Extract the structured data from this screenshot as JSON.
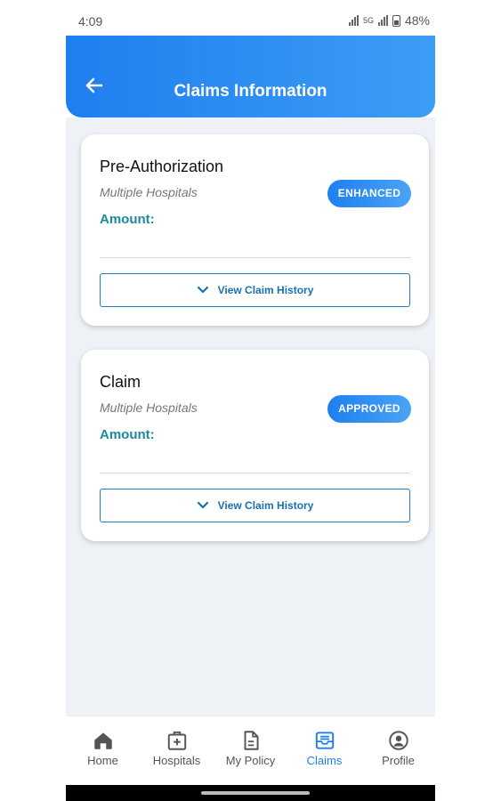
{
  "status_bar": {
    "time": "4:09",
    "network": "5G",
    "battery": "48%"
  },
  "header": {
    "title": "Claims Information"
  },
  "cards": [
    {
      "title": "Pre-Authorization",
      "subtitle": "Multiple Hospitals",
      "amount_label": "Amount:",
      "status": "ENHANCED",
      "button": "View Claim History"
    },
    {
      "title": "Claim",
      "subtitle": "Multiple Hospitals",
      "amount_label": "Amount:",
      "status": "APPROVED",
      "button": "View Claim History"
    }
  ],
  "nav": [
    {
      "label": "Home",
      "icon": "home-icon"
    },
    {
      "label": "Hospitals",
      "icon": "hospital-icon"
    },
    {
      "label": "My Policy",
      "icon": "document-icon"
    },
    {
      "label": "Claims",
      "icon": "claims-tray-icon",
      "active": true
    },
    {
      "label": "Profile",
      "icon": "profile-icon"
    }
  ],
  "colors": {
    "primary": "#1e7ff0",
    "amount": "#1a8aa0",
    "background": "#eef2f7"
  }
}
